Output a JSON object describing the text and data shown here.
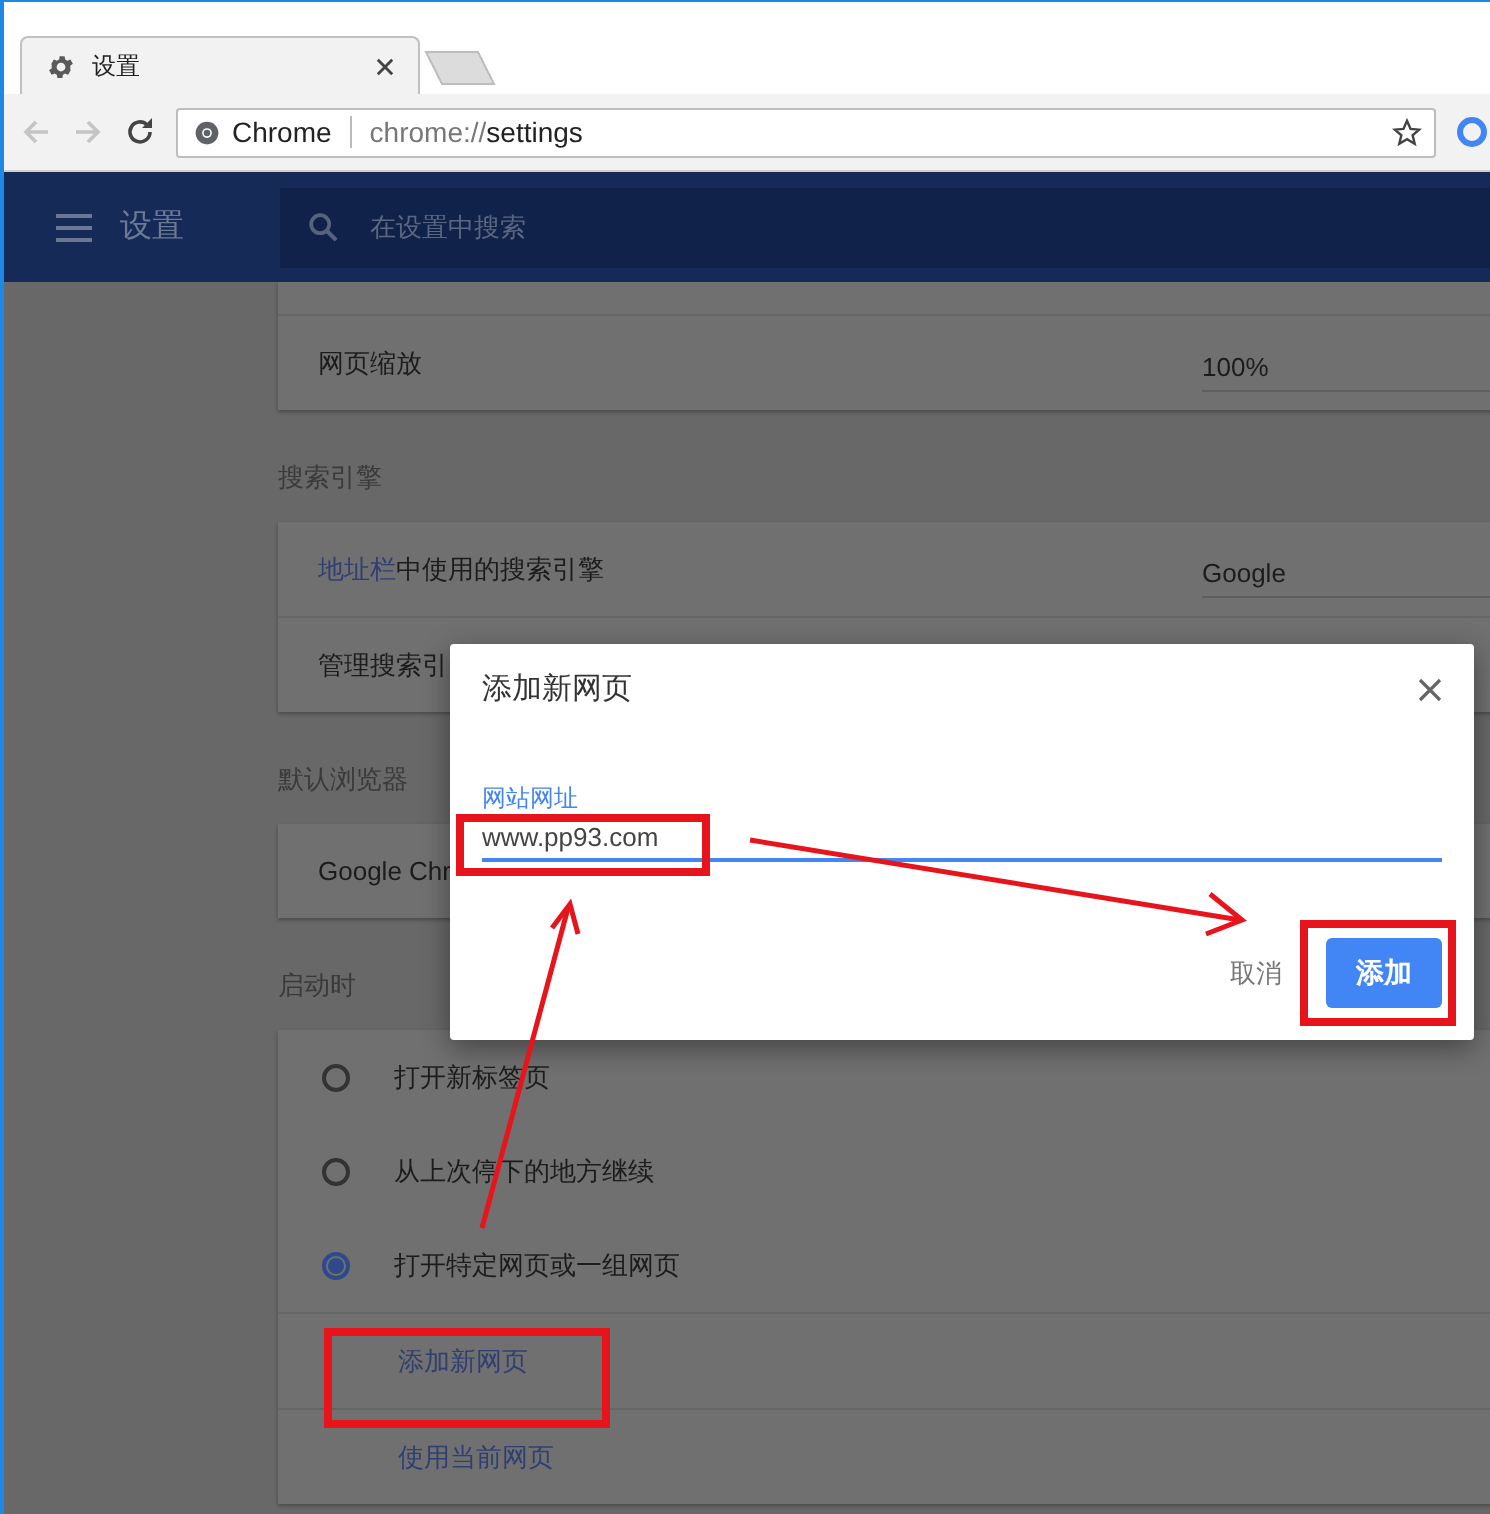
{
  "browser": {
    "tabs": [
      {
        "title": "设置",
        "selected": true
      }
    ],
    "address_bar": {
      "site_label": "Chrome",
      "url_scheme": "chrome://",
      "url_path": "settings"
    }
  },
  "header": {
    "title": "设置",
    "search": {
      "placeholder": "在设置中搜索"
    }
  },
  "sections": [
    {
      "rows": [
        {
          "kind": "blank"
        },
        {
          "kind": "value",
          "label": "网页缩放",
          "value": "100%"
        }
      ]
    },
    {
      "heading": "搜索引擎",
      "rows": [
        {
          "kind": "value",
          "link": "地址栏",
          "label": "中使用的搜索引擎",
          "value": "Google"
        },
        {
          "kind": "plain",
          "label": "管理搜索引"
        }
      ]
    },
    {
      "heading": "默认浏览器",
      "rows": [
        {
          "kind": "plain",
          "label": "Google Chr"
        }
      ]
    },
    {
      "heading": "启动时",
      "rows": [
        {
          "kind": "radio",
          "label": "打开新标签页",
          "selected": false
        },
        {
          "kind": "radio",
          "label": "从上次停下的地方继续",
          "selected": false
        },
        {
          "kind": "radio",
          "label": "打开特定网页或一组网页",
          "selected": true
        },
        {
          "kind": "link",
          "label": "添加新网页"
        },
        {
          "kind": "link",
          "label": "使用当前网页"
        }
      ]
    }
  ],
  "dialog": {
    "title": "添加新网页",
    "field": {
      "label": "网站网址",
      "value": "www.pp93.com"
    },
    "buttons": [
      {
        "kind": "text",
        "label": "取消"
      },
      {
        "kind": "primary",
        "label": "添加"
      }
    ]
  }
}
